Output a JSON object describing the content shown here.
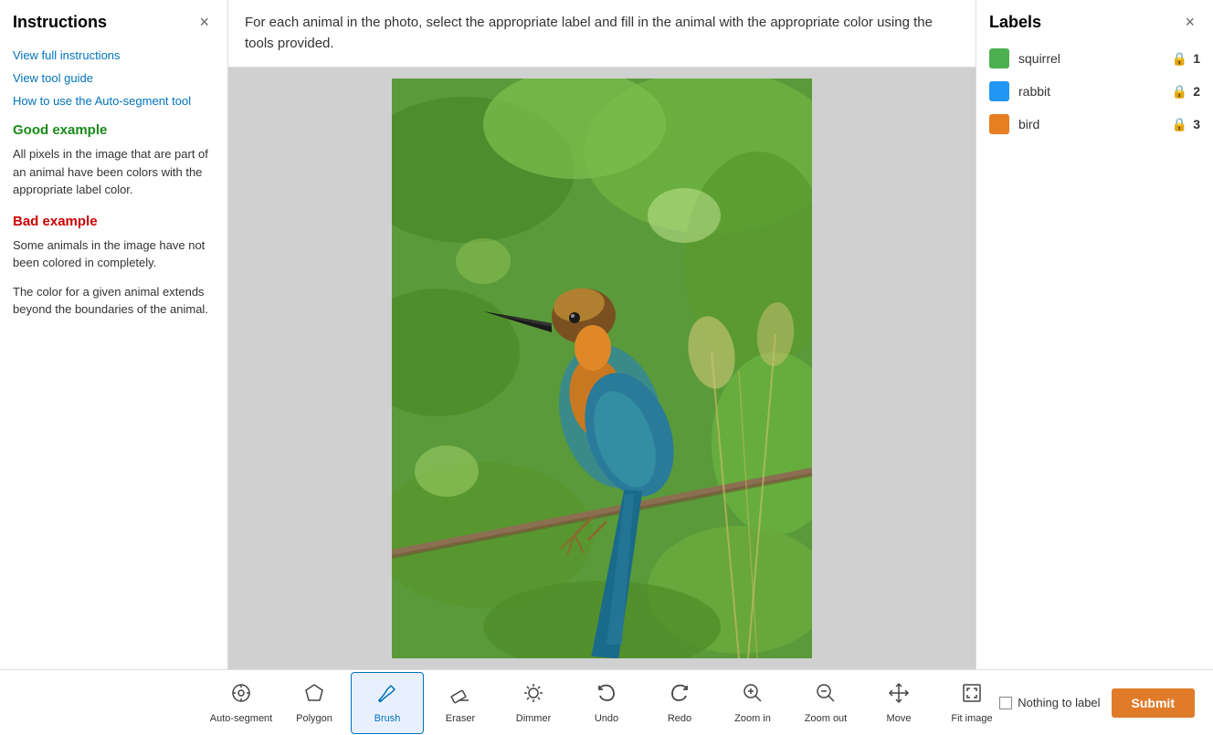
{
  "sidebar": {
    "title": "Instructions",
    "close_label": "×",
    "links": [
      {
        "id": "view-full",
        "text": "View full instructions"
      },
      {
        "id": "view-tool",
        "text": "View tool guide"
      },
      {
        "id": "auto-segment",
        "text": "How to use the Auto-segment tool"
      }
    ],
    "good_example_title": "Good example",
    "good_example_text": "All pixels in the image that are part of an animal have been colors with the appropriate label color.",
    "bad_example_title": "Bad example",
    "bad_example_text1": "Some animals in the image have not been colored in completely.",
    "bad_example_text2": "The color for a given animal extends beyond the boundaries of the animal."
  },
  "instruction_bar": {
    "text": "For each animal in the photo, select the appropriate label and fill in the animal with the appropriate color using the tools provided."
  },
  "labels": {
    "title": "Labels",
    "close_label": "×",
    "items": [
      {
        "name": "squirrel",
        "color": "#4caf50",
        "number": "1"
      },
      {
        "name": "rabbit",
        "color": "#2196f3",
        "number": "2"
      },
      {
        "name": "bird",
        "color": "#e67e22",
        "number": "3"
      }
    ]
  },
  "toolbar": {
    "tools": [
      {
        "id": "auto-segment",
        "label": "Auto-segment",
        "icon": "⊙"
      },
      {
        "id": "polygon",
        "label": "Polygon",
        "icon": "polygon"
      },
      {
        "id": "brush",
        "label": "Brush",
        "icon": "brush",
        "active": true
      },
      {
        "id": "eraser",
        "label": "Eraser",
        "icon": "eraser"
      },
      {
        "id": "dimmer",
        "label": "Dimmer",
        "icon": "dimmer"
      },
      {
        "id": "undo",
        "label": "Undo",
        "icon": "↩"
      },
      {
        "id": "redo",
        "label": "Redo",
        "icon": "↪"
      },
      {
        "id": "zoom-in",
        "label": "Zoom in",
        "icon": "zoom-in"
      },
      {
        "id": "zoom-out",
        "label": "Zoom out",
        "icon": "zoom-out"
      },
      {
        "id": "move",
        "label": "Move",
        "icon": "move"
      },
      {
        "id": "fit-image",
        "label": "Fit image",
        "icon": "fit"
      }
    ],
    "nothing_to_label": "Nothing to label",
    "submit_label": "Submit"
  }
}
